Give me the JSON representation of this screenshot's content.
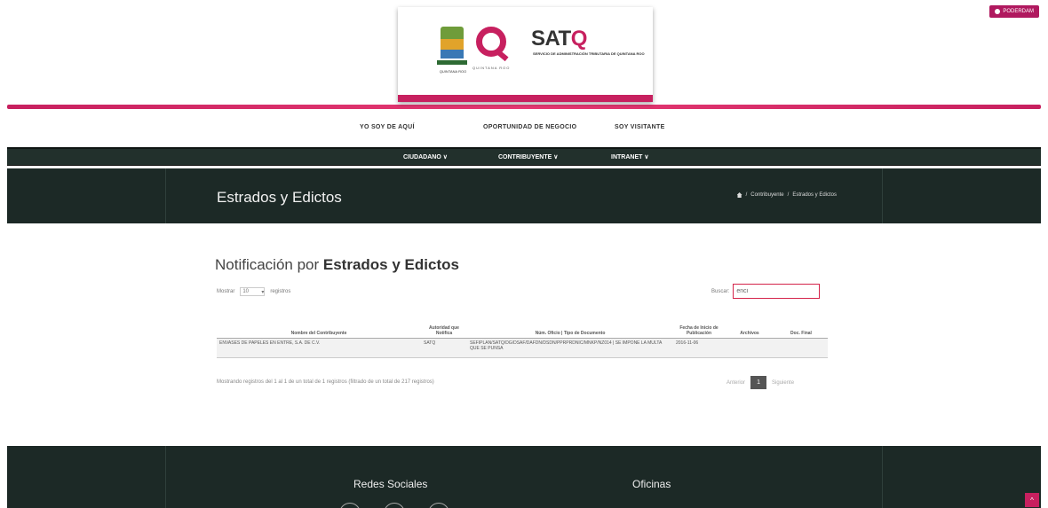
{
  "header": {
    "top_button_label": "PODERDAM",
    "logo_sat": "SAT",
    "logo_sat_q": "Q",
    "logo_subtitle": "SERVICIO DE ADMINISTRACIÓN TRIBUTARIA DE QUINTANA ROO",
    "logo_q_caption": "QUINTANA ROO",
    "emblem_caption": "QUINTANA ROO",
    "top_links": [
      "YO SOY DE AQUÍ",
      "OPORTUNIDAD DE NEGOCIO",
      "SOY VISITANTE"
    ]
  },
  "nav": {
    "items": [
      "CIUDADANO ∨",
      "CONTRIBUYENTE ∨",
      "INTRANET ∨"
    ]
  },
  "titlebar": {
    "title": "Estrados y Edictos",
    "breadcrumb_1": "Contribuyente",
    "breadcrumb_2": "Estrados y Edictos",
    "separator": "/"
  },
  "content": {
    "heading_prefix": "Notificación por ",
    "heading_bold": "Estrados y Edictos",
    "show_label": "Mostrar",
    "show_value": "10",
    "show_suffix": "registros",
    "search_label": "Buscar:",
    "search_value": "enci",
    "table": {
      "headers": [
        "Nombre del Contribuyente",
        "Autoridad que Notifica",
        "Núm. Oficio | Tipo de Documento",
        "Fecha de Inicio de Publicación",
        "Archivos",
        "Doc. Final"
      ],
      "rows": [
        [
          "ENVASES DE PAPELES EN ENTRE, S.A. DE C.V.",
          "SATQ",
          "SEFIPLAN/SATQ/DG/DSAF/DAFDN/DSDN/PPRPRDNIC/MNKP/NZ014 | SE IMPONE LA MULTA QUE SE PUNSA",
          "2016-11-06",
          "",
          ""
        ]
      ]
    },
    "info": "Mostrando registros del 1 al 1 de un total de 1 registros (filtrado de un total de 217 registros)",
    "pager": {
      "prev": "Anterior",
      "current": "1",
      "next": "Siguiente"
    }
  },
  "footer": {
    "social_title": "Redes Sociales",
    "offices_title": "Oficinas",
    "up_icon": "^"
  }
}
